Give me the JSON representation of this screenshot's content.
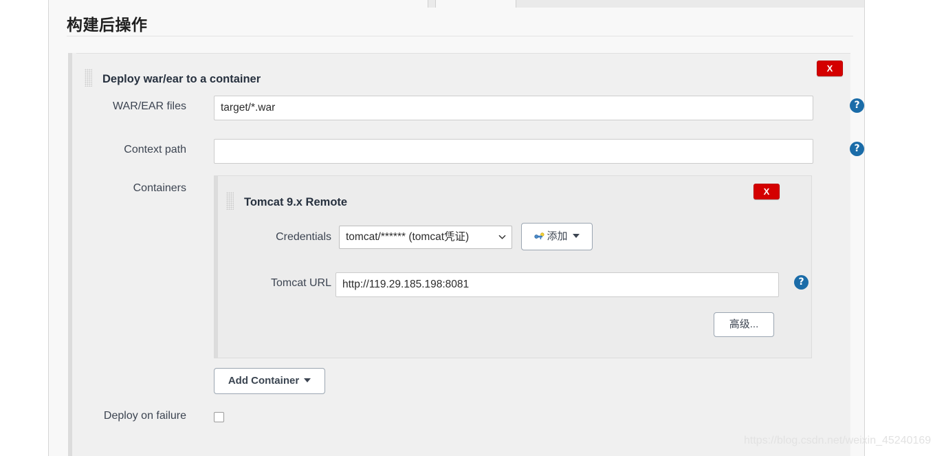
{
  "page": {
    "section_title": "构建后操作",
    "watermark": "https://blog.csdn.net/weixin_45240169"
  },
  "post_build_step": {
    "title": "Deploy war/ear to a container",
    "delete_label": "X",
    "fields": {
      "war_ear": {
        "label": "WAR/EAR files",
        "value": "target/*.war",
        "placeholder": "",
        "help": "?"
      },
      "context_path": {
        "label": "Context path",
        "value": "",
        "placeholder": "",
        "help": "?"
      },
      "containers_label": "Containers",
      "deploy_on_failure": {
        "label": "Deploy on failure",
        "checked": false
      }
    },
    "add_container_button": "Add Container"
  },
  "container": {
    "title": "Tomcat 9.x Remote",
    "delete_label": "X",
    "credentials": {
      "label": "Credentials",
      "selected": "tomcat/****** (tomcat凭证)",
      "options": [
        "tomcat/****** (tomcat凭证)"
      ],
      "add_button": "添加"
    },
    "tomcat_url": {
      "label": "Tomcat URL",
      "value": "http://119.29.185.198:8081",
      "placeholder": "",
      "help": "?"
    },
    "advanced_button": "高级..."
  },
  "colors": {
    "danger": "#d40000",
    "help_blue": "#1b6ca8",
    "panel_outer_bg": "#f0f0f0",
    "panel_inner_bg": "#ececec",
    "page_bg": "#f8f8f8"
  }
}
